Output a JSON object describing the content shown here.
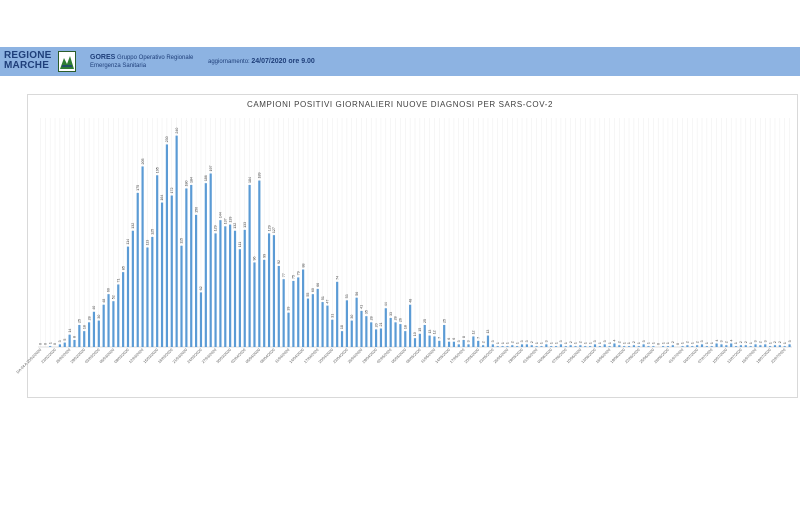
{
  "header": {
    "logo_line1": "REGIONE",
    "logo_line2": "MARCHE",
    "org_name": "GORES",
    "org_desc_1": "Gruppo Operativo Regionale",
    "org_desc_2": "Emergenza Sanitaria",
    "update_label": "aggiornamento:",
    "update_value": "24/07/2020 ore 9.00",
    "bg_color": "#8db3e2"
  },
  "chart_data": {
    "type": "bar",
    "title": "CAMPIONI POSITIVI GIORNALIERI NUOVE DIAGNOSI PER SARS-COV-2",
    "xlabel": "",
    "ylabel": "",
    "ylim": [
      0,
      260
    ],
    "grid": true,
    "legend": "none",
    "bar_color": "#5b9bd5",
    "categories": [
      "DA 04 A 20/02/2020",
      "21/02/2020",
      "22/02/2020",
      "23/02/2020",
      "24/02/2020",
      "25/02/2020",
      "26/02/2020",
      "27/02/2020",
      "28/02/2020",
      "29/02/2020",
      "01/03/2020",
      "02/03/2020",
      "03/03/2020",
      "04/03/2020",
      "05/03/2020",
      "06/03/2020",
      "07/03/2020",
      "08/03/2020",
      "09/03/2020",
      "10/03/2020",
      "11/03/2020",
      "12/03/2020",
      "13/03/2020",
      "14/03/2020",
      "15/03/2020",
      "16/03/2020",
      "17/03/2020",
      "18/03/2020",
      "19/03/2020",
      "20/03/2020",
      "21/03/2020",
      "22/03/2020",
      "23/03/2020",
      "24/03/2020",
      "25/03/2020",
      "26/03/2020",
      "27/03/2020",
      "28/03/2020",
      "29/03/2020",
      "30/03/2020",
      "31/03/2020",
      "01/04/2020",
      "02/04/2020",
      "03/04/2020",
      "04/04/2020",
      "05/04/2020",
      "06/04/2020",
      "07/04/2020",
      "08/04/2020",
      "09/04/2020",
      "10/04/2020",
      "11/04/2020",
      "12/04/2020",
      "13/04/2020",
      "14/04/2020",
      "15/04/2020",
      "16/04/2020",
      "17/04/2020",
      "18/04/2020",
      "19/04/2020",
      "20/04/2020",
      "21/04/2020",
      "22/04/2020",
      "23/04/2020",
      "24/04/2020",
      "25/04/2020",
      "26/04/2020",
      "27/04/2020",
      "28/04/2020",
      "29/04/2020",
      "30/04/2020",
      "01/05/2020",
      "02/05/2020",
      "03/05/2020",
      "04/05/2020",
      "05/05/2020",
      "06/05/2020",
      "07/05/2020",
      "08/05/2020",
      "09/05/2020",
      "10/05/2020",
      "11/05/2020",
      "12/05/2020",
      "13/05/2020",
      "14/05/2020",
      "15/05/2020",
      "16/05/2020",
      "17/05/2020",
      "18/05/2020",
      "19/05/2020",
      "20/05/2020",
      "21/05/2020",
      "22/05/2020",
      "23/05/2020",
      "24/05/2020",
      "25/05/2020",
      "26/05/2020",
      "27/05/2020",
      "28/05/2020",
      "29/05/2020",
      "30/05/2020",
      "31/05/2020",
      "01/06/2020",
      "02/06/2020",
      "03/06/2020",
      "04/06/2020",
      "05/06/2020",
      "06/06/2020",
      "07/06/2020",
      "08/06/2020",
      "09/06/2020",
      "10/06/2020",
      "11/06/2020",
      "12/06/2020",
      "13/06/2020",
      "14/06/2020",
      "15/06/2020",
      "16/06/2020",
      "17/06/2020",
      "18/06/2020",
      "19/06/2020",
      "20/06/2020",
      "21/06/2020",
      "22/06/2020",
      "23/06/2020",
      "24/06/2020",
      "25/06/2020",
      "26/06/2020",
      "27/06/2020",
      "28/06/2020",
      "29/06/2020",
      "30/06/2020",
      "01/07/2020",
      "02/07/2020",
      "03/07/2020",
      "04/07/2020",
      "05/07/2020",
      "06/07/2020",
      "07/07/2020",
      "08/07/2020",
      "09/07/2020",
      "10/07/2020",
      "11/07/2020",
      "12/07/2020",
      "13/07/2020",
      "14/07/2020",
      "15/07/2020",
      "16/07/2020",
      "17/07/2020",
      "18/07/2020",
      "19/07/2020",
      "20/07/2020",
      "21/07/2020",
      "22/07/2020",
      "23/07/2020"
    ],
    "tick_labels": [
      "DA 04 A 20/02/2020",
      "23/02/2020",
      "26/02/2020",
      "29/02/2020",
      "03/03/2020",
      "06/03/2020",
      "09/03/2020",
      "12/03/2020",
      "15/03/2020",
      "18/03/2020",
      "21/03/2020",
      "24/03/2020",
      "27/03/2020",
      "30/03/2020",
      "02/04/2020",
      "05/04/2020",
      "08/04/2020",
      "11/04/2020",
      "14/04/2020",
      "17/04/2020",
      "20/04/2020",
      "23/04/2020",
      "26/04/2020",
      "29/04/2020",
      "02/05/2020",
      "05/05/2020",
      "08/05/2020",
      "11/05/2020",
      "14/05/2020",
      "17/05/2020",
      "20/05/2020",
      "23/05/2020",
      "26/05/2020",
      "29/05/2020",
      "01/06/2020",
      "04/06/2020",
      "07/06/2020",
      "10/06/2020",
      "13/06/2020",
      "16/06/2020",
      "19/06/2020",
      "22/06/2020",
      "25/06/2020",
      "28/06/2020",
      "01/07/2020",
      "04/07/2020",
      "07/07/2020",
      "10/07/2020",
      "13/07/2020",
      "16/07/2020",
      "19/07/2020",
      "22/07/2020"
    ],
    "values": [
      0,
      0,
      1,
      0,
      3,
      5,
      14,
      8,
      25,
      18,
      28,
      40,
      30,
      48,
      60,
      52,
      71,
      85,
      114,
      132,
      175,
      205,
      113,
      125,
      195,
      164,
      230,
      172,
      240,
      115,
      180,
      184,
      150,
      62,
      186,
      197,
      129,
      144,
      137,
      139,
      132,
      111,
      133,
      184,
      96,
      189,
      99,
      129,
      127,
      92,
      77,
      39,
      75,
      79,
      88,
      55,
      60,
      66,
      51,
      47,
      31,
      74,
      18,
      53,
      30,
      56,
      41,
      35,
      28,
      20,
      21,
      44,
      33,
      28,
      26,
      18,
      48,
      10,
      15,
      25,
      13,
      12,
      7,
      25,
      6,
      6,
      3,
      8,
      3,
      12,
      7,
      2,
      13,
      3,
      1,
      1,
      1,
      2,
      1,
      3,
      3,
      2,
      1,
      1,
      3,
      1,
      1,
      3,
      1,
      2,
      1,
      2,
      1,
      1,
      3,
      1,
      3,
      1,
      4,
      2,
      1,
      1,
      2,
      1,
      3,
      1,
      1,
      0,
      1,
      1,
      2,
      0,
      1,
      2,
      1,
      2,
      3,
      1,
      1,
      4,
      3,
      2,
      4,
      1,
      2,
      2,
      1,
      3,
      2,
      3,
      1,
      2,
      2,
      1,
      3
    ]
  }
}
